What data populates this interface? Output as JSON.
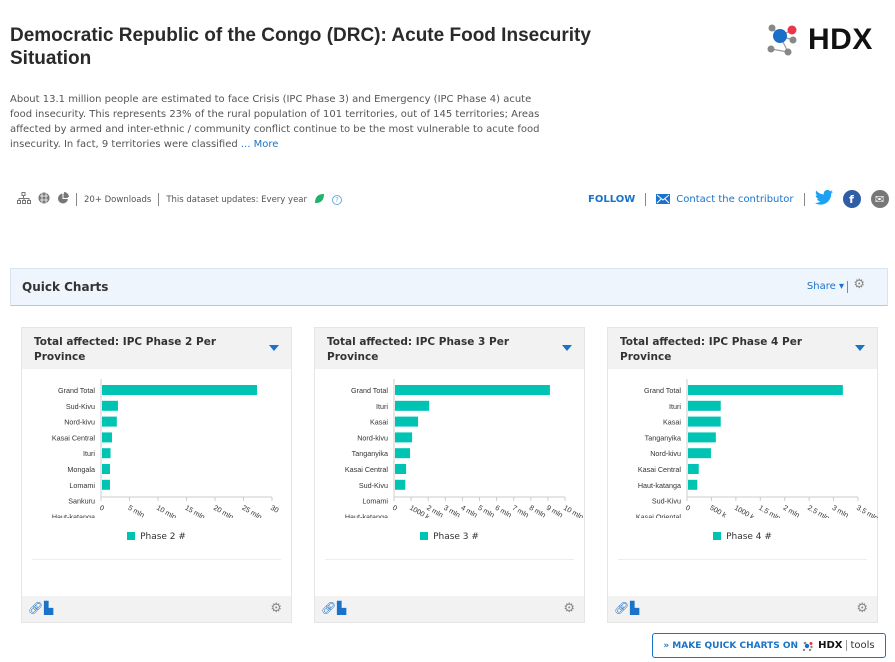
{
  "header": {
    "title": "Democratic Republic of the Congo (DRC): Acute Food Insecurity Situation",
    "logo_text": "HDX",
    "description": "About 13.1 million people are estimated to face Crisis (IPC Phase 3) and Emergency (IPC Phase 4) acute food insecurity. This represents 23% of the rural population of 101 territories, out of 145 territories; Areas affected by armed and inter-ethnic / community conflict continue to be the most vulnerable to acute food insecurity. In fact, 9 territories were classified",
    "more_link": "... More"
  },
  "meta": {
    "downloads": "20+ Downloads",
    "updates": "This dataset updates: Every year",
    "icons": [
      "sitemap-icon",
      "globe-icon",
      "pie-chart-icon",
      "leaf-icon",
      "help-icon"
    ]
  },
  "actions": {
    "follow": "FOLLOW",
    "contact": "Contact the contributor",
    "share_icons": [
      "twitter-icon",
      "facebook-icon",
      "email-icon"
    ]
  },
  "quick_charts": {
    "title": "Quick Charts",
    "share": "Share"
  },
  "colors": {
    "bar": "#00c4b3",
    "accent": "#1a73c8"
  },
  "make_button": {
    "prefix": "» MAKE QUICK CHARTS ON",
    "brand": "HDX",
    "suffix": "tools"
  },
  "chart_data": [
    {
      "type": "bar",
      "orientation": "horizontal",
      "title": "Total affected: IPC Phase 2 Per Province",
      "legend": "Phase 2 #",
      "categories": [
        "Grand Total",
        "Sud-Kivu",
        "Nord-kivu",
        "Kasai Central",
        "Ituri",
        "Mongala",
        "Lomami",
        "Sankuru",
        "Haut-katanga"
      ],
      "values": [
        27200000,
        2800000,
        2600000,
        1750000,
        1500000,
        1400000,
        1400000,
        1200000,
        null
      ],
      "xlim": [
        0,
        30000000
      ],
      "ticks": [
        0,
        5000000,
        10000000,
        15000000,
        20000000,
        25000000,
        30000000
      ],
      "tick_labels": [
        "0",
        "5 mln",
        "10 mln",
        "15 mln",
        "20 mln",
        "25 mln",
        "30"
      ]
    },
    {
      "type": "bar",
      "orientation": "horizontal",
      "title": "Total affected: IPC Phase 3 Per Province",
      "legend": "Phase 3 #",
      "categories": [
        "Grand Total",
        "Ituri",
        "Kasai",
        "Nord-kivu",
        "Tanganyika",
        "Kasai Central",
        "Sud-Kivu",
        "Lomami",
        "Haut-katanga"
      ],
      "values": [
        9060000,
        2000000,
        1350000,
        1000000,
        880000,
        650000,
        600000,
        300000,
        null
      ],
      "xlim": [
        0,
        10000000
      ],
      "ticks": [
        0,
        1000000,
        2000000,
        3000000,
        4000000,
        5000000,
        6000000,
        7000000,
        8000000,
        9000000,
        10000000
      ],
      "tick_labels": [
        "0",
        "1000 k",
        "2 mln",
        "3 mln",
        "4 mln",
        "5 mln",
        "6 mln",
        "7 mln",
        "8 mln",
        "9 mln",
        "10 mln"
      ]
    },
    {
      "type": "bar",
      "orientation": "horizontal",
      "title": "Total affected: IPC Phase 4 Per Province",
      "legend": "Phase 4 #",
      "categories": [
        "Grand Total",
        "Ituri",
        "Kasai",
        "Tanganyika",
        "Nord-kivu",
        "Kasai Central",
        "Haut-katanga",
        "Sud-Kivu",
        "Kasai Oriental"
      ],
      "values": [
        3170000,
        670000,
        670000,
        570000,
        470000,
        220000,
        190000,
        100000,
        null
      ],
      "xlim": [
        0,
        3500000
      ],
      "ticks": [
        0,
        500000,
        1000000,
        1500000,
        2000000,
        2500000,
        3000000,
        3500000
      ],
      "tick_labels": [
        "0",
        "500 k",
        "1000 k",
        "1.5 mln",
        "2 mln",
        "2.5 mln",
        "3 mln",
        "3.5 mln"
      ]
    }
  ]
}
